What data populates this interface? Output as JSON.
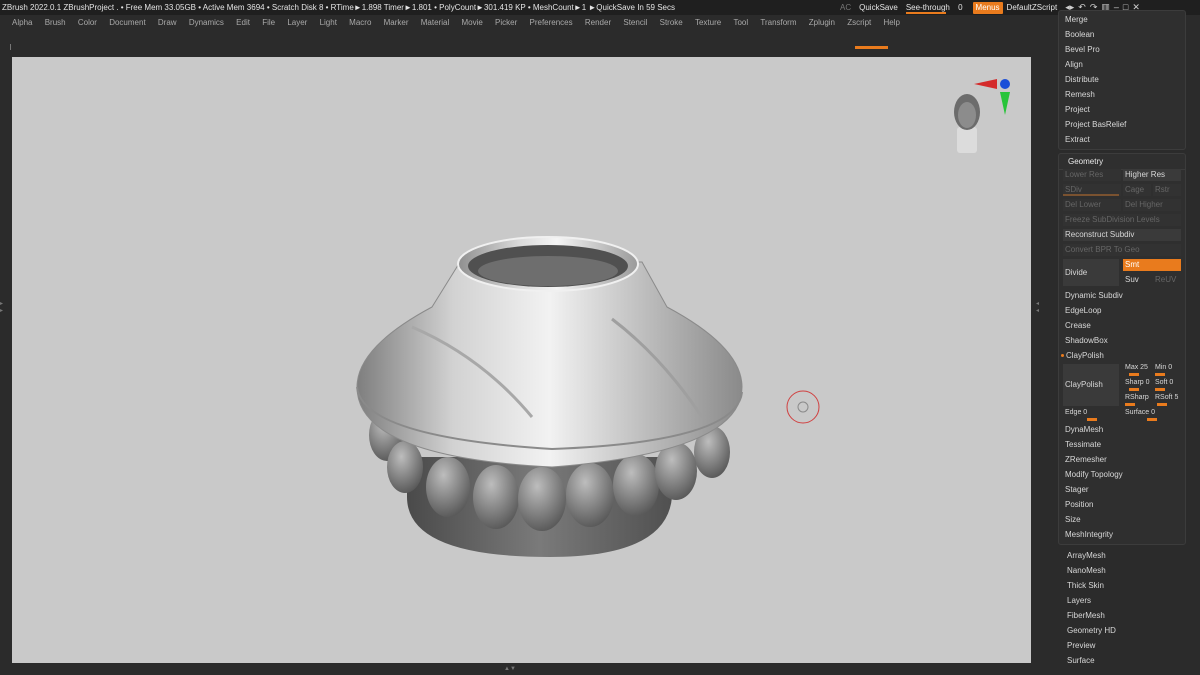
{
  "titlebar": {
    "app_info": "ZBrush 2022.0.1   ZBrushProject  .  • Free Mem 33.05GB • Active Mem 3694 • Scratch Disk 8 •  RTime►1.898 Timer►1.801 • PolyCount►301.419 KP  • MeshCount►1   ►QuickSave In 59 Secs",
    "ac": "AC",
    "quicksave": "QuickSave",
    "seethrough_label": "See-through",
    "seethrough_value": "0",
    "menus": "Menus",
    "default_script": "DefaultZScript"
  },
  "menubar": [
    "Alpha",
    "Brush",
    "Color",
    "Document",
    "Draw",
    "Dynamics",
    "Edit",
    "File",
    "Layer",
    "Light",
    "Macro",
    "Marker",
    "Material",
    "Movie",
    "Picker",
    "Preferences",
    "Render",
    "Stencil",
    "Stroke",
    "Texture",
    "Tool",
    "Transform",
    "Zplugin",
    "Zscript",
    "Help"
  ],
  "deformation_panel": {
    "items": [
      "Merge",
      "Boolean",
      "Bevel Pro",
      "Align",
      "Distribute",
      "Remesh",
      "Project",
      "Project BasRelief",
      "Extract"
    ]
  },
  "geometry_panel": {
    "title": "Geometry",
    "lower_res": "Lower Res",
    "higher_res": "Higher Res",
    "sdiv": "SDiv",
    "cage": "Cage",
    "rstr": "Rstr",
    "del_lower": "Del Lower",
    "del_higher": "Del Higher",
    "freeze_subdiv": "Freeze SubDivision Levels",
    "reconstruct_subdiv": "Reconstruct Subdiv",
    "convert_bpr": "Convert BPR To Geo",
    "divide": "Divide",
    "smt": "Smt",
    "suv": "Suv",
    "reuv": "ReUV",
    "dynamic_subdiv": "Dynamic Subdiv",
    "edgeloop": "EdgeLoop",
    "crease": "Crease",
    "shadowbox": "ShadowBox",
    "claypolish_header": "ClayPolish",
    "claypolish_button": "ClayPolish",
    "max": "Max 25",
    "min": "Min 0",
    "sharp": "Sharp",
    "sharp_value": "0",
    "soft": "Soft 0",
    "rsharp": "RSharp",
    "rsoft": "RSoft 5",
    "edge": "Edge 0",
    "surface": "Surface 0",
    "more": [
      "DynaMesh",
      "Tessimate",
      "ZRemesher",
      "Modify Topology",
      "Stager",
      "Position",
      "Size",
      "MeshIntegrity"
    ]
  },
  "bottom_list": [
    "ArrayMesh",
    "NanoMesh",
    "Thick Skin",
    "Layers",
    "FiberMesh",
    "Geometry HD",
    "Preview",
    "Surface"
  ],
  "colors": {
    "accent": "#e97b1d",
    "viewport": "#c9c9c9",
    "panel": "#2f2f2f"
  }
}
